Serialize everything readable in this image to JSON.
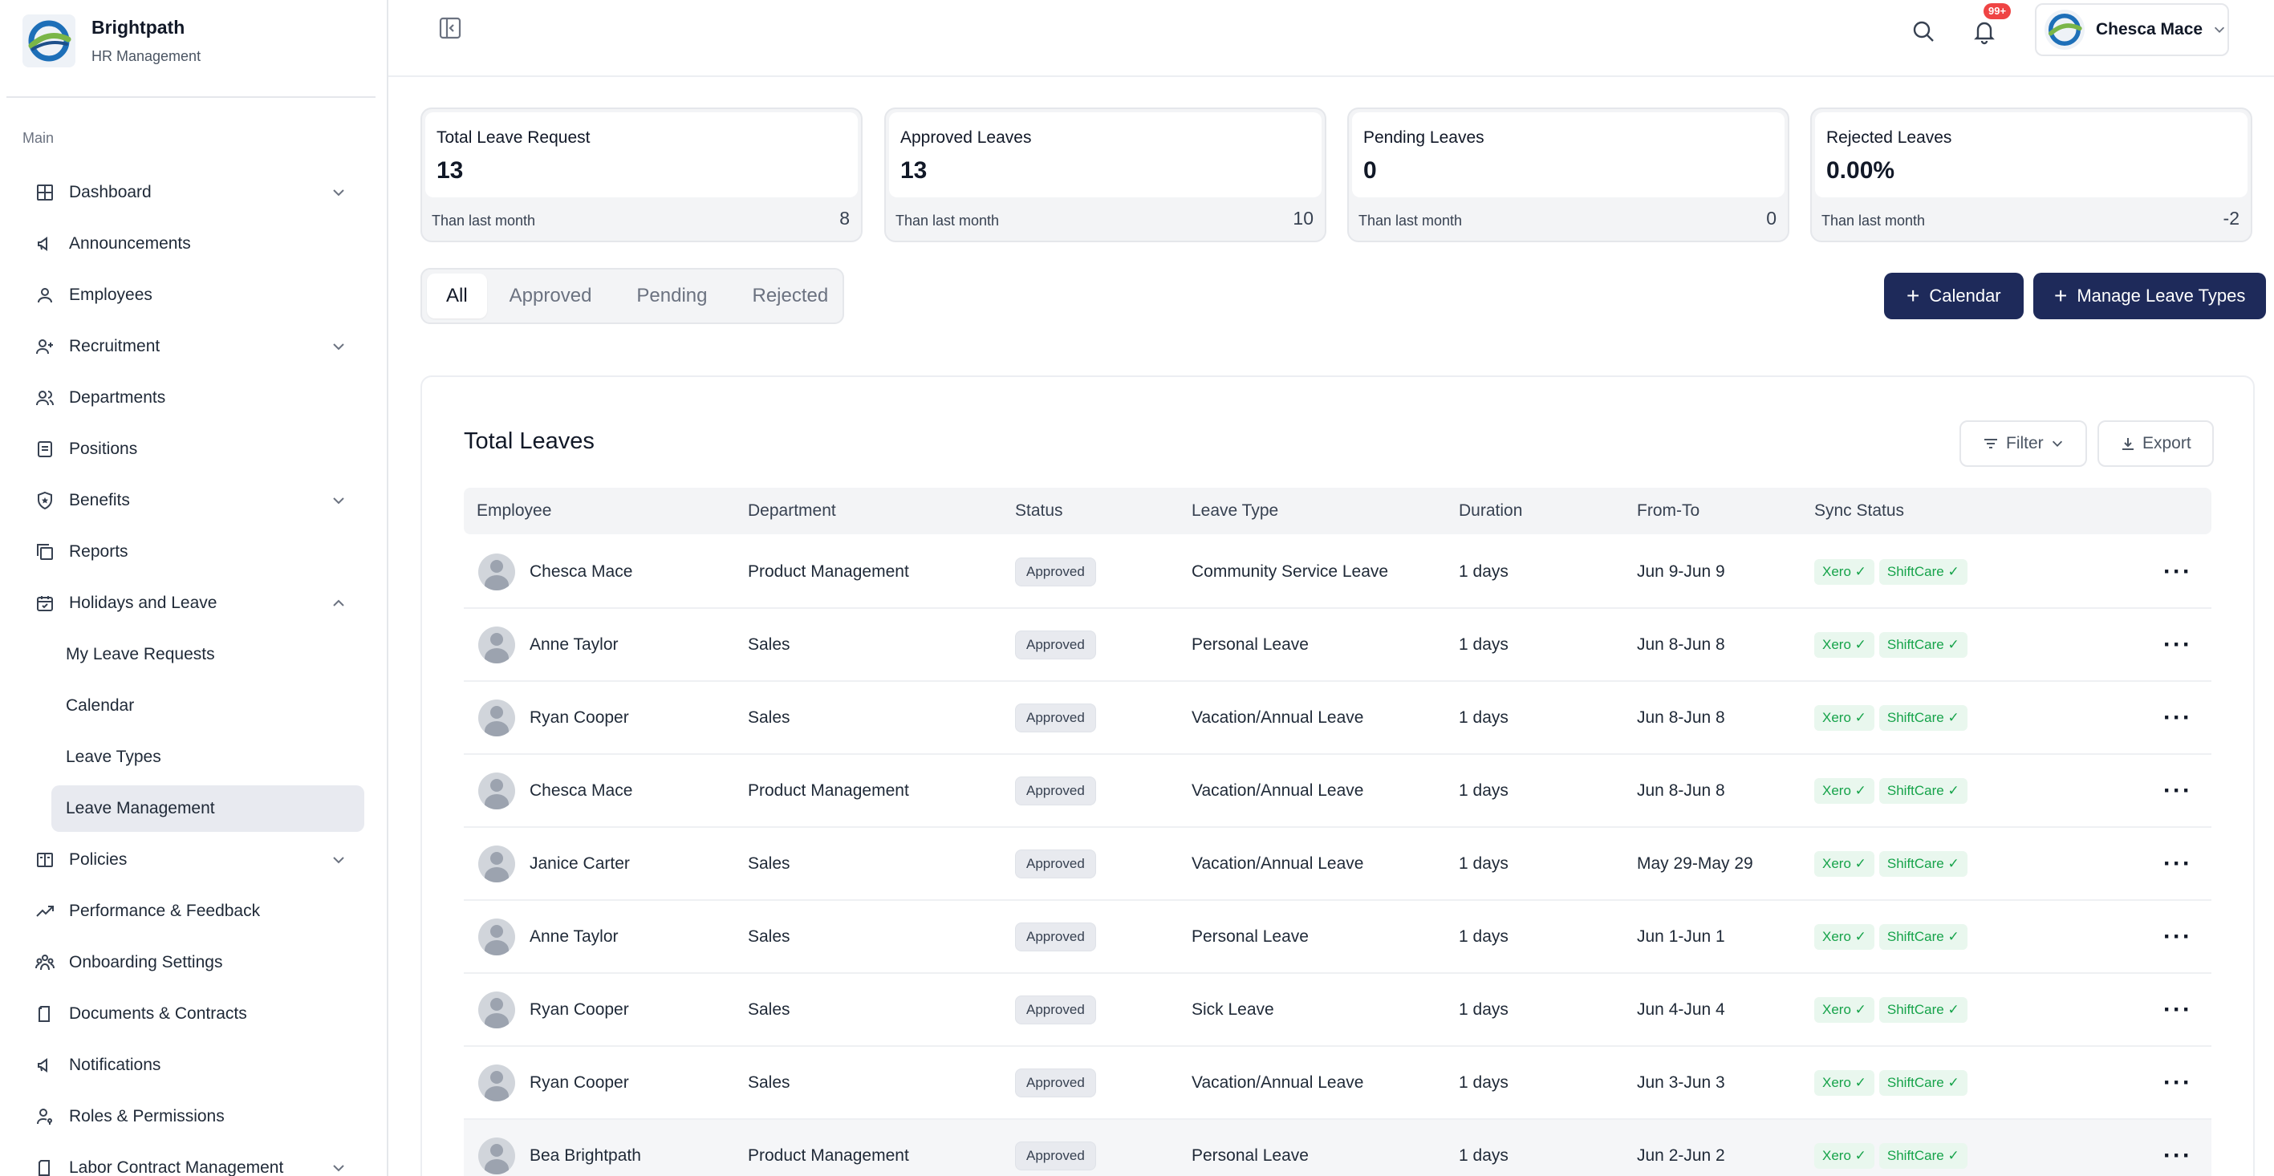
{
  "brand": {
    "name": "Brightpath",
    "subtitle": "HR Management"
  },
  "sidebar": {
    "section": "Main",
    "items": [
      {
        "label": "Dashboard",
        "icon": "grid-icon",
        "chevron": "down"
      },
      {
        "label": "Announcements",
        "icon": "megaphone-icon"
      },
      {
        "label": "Employees",
        "icon": "user-icon"
      },
      {
        "label": "Recruitment",
        "icon": "user-plus-icon",
        "chevron": "down"
      },
      {
        "label": "Departments",
        "icon": "users-icon"
      },
      {
        "label": "Positions",
        "icon": "clipboard-icon"
      },
      {
        "label": "Benefits",
        "icon": "shield-star-icon",
        "chevron": "down"
      },
      {
        "label": "Reports",
        "icon": "stack-icon"
      },
      {
        "label": "Holidays and Leave",
        "icon": "calendar-check-icon",
        "chevron": "up"
      }
    ],
    "leave_sub": [
      "My Leave Requests",
      "Calendar",
      "Leave Types",
      "Leave Management"
    ],
    "items_after": [
      {
        "label": "Policies",
        "icon": "book-icon",
        "chevron": "down"
      },
      {
        "label": "Performance & Feedback",
        "icon": "trend-icon"
      },
      {
        "label": "Onboarding Settings",
        "icon": "people-group-icon"
      },
      {
        "label": "Documents & Contracts",
        "icon": "document-icon"
      },
      {
        "label": "Notifications",
        "icon": "megaphone-icon"
      },
      {
        "label": "Roles & Permissions",
        "icon": "user-key-icon"
      },
      {
        "label": "Labor Contract Management",
        "icon": "document-icon",
        "chevron": "down"
      }
    ]
  },
  "header": {
    "notification_badge": "99+",
    "user_name": "Chesca Mace"
  },
  "stats": [
    {
      "title": "Total Leave Request",
      "value": "13",
      "foot_label": "Than last month",
      "foot_value": "8"
    },
    {
      "title": "Approved Leaves",
      "value": "13",
      "foot_label": "Than last month",
      "foot_value": "10"
    },
    {
      "title": "Pending Leaves",
      "value": "0",
      "foot_label": "Than last month",
      "foot_value": "0"
    },
    {
      "title": "Rejected Leaves",
      "value": "0.00%",
      "foot_label": "Than last month",
      "foot_value": "-2"
    }
  ],
  "tabs": [
    "All",
    "Approved",
    "Pending",
    "Rejected"
  ],
  "buttons": {
    "calendar": "Calendar",
    "manage": "Manage Leave Types",
    "filter": "Filter",
    "export": "Export"
  },
  "table": {
    "title": "Total Leaves",
    "headers": [
      "Employee",
      "Department",
      "Status",
      "Leave Type",
      "Duration",
      "From-To",
      "Sync Status"
    ],
    "rows": [
      {
        "employee": "Chesca Mace",
        "department": "Product Management",
        "status": "Approved",
        "leave_type": "Community Service Leave",
        "duration": "1 days",
        "from_to": "Jun 9-Jun 9"
      },
      {
        "employee": "Anne Taylor",
        "department": "Sales",
        "status": "Approved",
        "leave_type": "Personal Leave",
        "duration": "1 days",
        "from_to": "Jun 8-Jun 8"
      },
      {
        "employee": "Ryan Cooper",
        "department": "Sales",
        "status": "Approved",
        "leave_type": "Vacation/Annual Leave",
        "duration": "1 days",
        "from_to": "Jun 8-Jun 8"
      },
      {
        "employee": "Chesca Mace",
        "department": "Product Management",
        "status": "Approved",
        "leave_type": "Vacation/Annual Leave",
        "duration": "1 days",
        "from_to": "Jun 8-Jun 8"
      },
      {
        "employee": "Janice Carter",
        "department": "Sales",
        "status": "Approved",
        "leave_type": "Vacation/Annual Leave",
        "duration": "1 days",
        "from_to": "May 29-May 29"
      },
      {
        "employee": "Anne Taylor",
        "department": "Sales",
        "status": "Approved",
        "leave_type": "Personal Leave",
        "duration": "1 days",
        "from_to": "Jun 1-Jun 1"
      },
      {
        "employee": "Ryan Cooper",
        "department": "Sales",
        "status": "Approved",
        "leave_type": "Sick Leave",
        "duration": "1 days",
        "from_to": "Jun 4-Jun 4"
      },
      {
        "employee": "Ryan Cooper",
        "department": "Sales",
        "status": "Approved",
        "leave_type": "Vacation/Annual Leave",
        "duration": "1 days",
        "from_to": "Jun 3-Jun 3"
      },
      {
        "employee": "Bea Brightpath",
        "department": "Product Management",
        "status": "Approved",
        "leave_type": "Personal Leave",
        "duration": "1 days",
        "from_to": "Jun 2-Jun 2"
      }
    ],
    "sync": [
      "Xero ✓",
      "ShiftCare ✓"
    ],
    "more_label": "···"
  },
  "colors": {
    "primary": "#1e2a5a",
    "sync_green": "#16a34a",
    "badge_red": "#ef4444"
  }
}
